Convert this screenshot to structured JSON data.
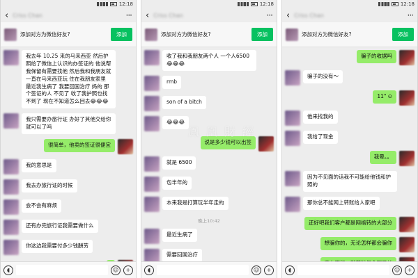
{
  "panels": [
    {
      "status": {
        "time": "12:18"
      },
      "header": {
        "contact_name": "Criss Chan",
        "back_icon": "‹",
        "more_icon": "···"
      },
      "add_friend": {
        "text": "添加对方为微信好友?",
        "button_label": "添加"
      },
      "messages": [
        {
          "side": "left",
          "text": "我去年 10.25 来的马来西亚 然后护照给了微信上认识的办签证的 他说帮我保留有需要找他 然后我和我朋友就一直在马来西亚玩 住在我朋友家里 最近我生病了 我要回国治疗 妈的 那个签证的人 不见了 收了我护照也找不到了 现在不知道怎么回去😂😂😂"
        },
        {
          "side": "left",
          "text": "我只需要办旅行证 办好了其他交给你就可以了吗"
        },
        {
          "side": "right",
          "text": "很简单，他卖的签证很便宜"
        },
        {
          "side": "left",
          "text": "我的意思是"
        },
        {
          "side": "left",
          "text": "我去办旅行证的时候"
        },
        {
          "side": "left",
          "text": "会不会有麻烦"
        },
        {
          "side": "left",
          "text": "还有办完旅行证我需要做什么"
        },
        {
          "side": "left",
          "text": "你这边我需要付多少钱酬劳"
        },
        {
          "side": "right",
          "text": "",
          "partial": true
        }
      ],
      "time_label": ""
    },
    {
      "status": {
        "time": "12:18"
      },
      "header": {
        "contact_name": "Criss Chan",
        "back_icon": "‹",
        "more_icon": "···"
      },
      "add_friend": {
        "text": "添加对方为微信好友?",
        "button_label": "添加"
      },
      "messages": [
        {
          "side": "left",
          "text": "收了我和我朋友两个人 一个人6500😂😂😂"
        },
        {
          "side": "left",
          "text": "rmb"
        },
        {
          "side": "left",
          "text": "son of a bitch"
        },
        {
          "side": "left",
          "text": "😂😂😂"
        },
        {
          "side": "right",
          "text": "说是多少钱可以出签"
        },
        {
          "side": "left",
          "text": "就是 6500"
        },
        {
          "side": "left",
          "text": "包半年的"
        },
        {
          "side": "left",
          "text": "本来我是打算玩半年走的"
        },
        {
          "side": "time",
          "text": "晚上10:42"
        },
        {
          "side": "left",
          "text": "最近生病了"
        },
        {
          "side": "left",
          "text": "需要回国治疗"
        },
        {
          "side": "left",
          "text": "然后找那个人要护照"
        }
      ]
    },
    {
      "status": {
        "time": "12:18"
      },
      "header": {
        "contact_name": "Criss Chan",
        "back_icon": "‹",
        "more_icon": "···"
      },
      "add_friend": {
        "text": "添加对方为微信好友?",
        "button_label": "添加"
      },
      "messages": [
        {
          "side": "right",
          "text": "骗子的收据吗"
        },
        {
          "side": "left",
          "text": "骗子的没有～"
        },
        {
          "side": "right",
          "text": "11\" ⊙"
        },
        {
          "side": "left",
          "text": "他来找我的"
        },
        {
          "side": "left",
          "text": "我给了现金"
        },
        {
          "side": "right",
          "text": "我晕。。"
        },
        {
          "side": "left",
          "text": "因为不见面的话我不可能给他钱和护照的"
        },
        {
          "side": "left",
          "text": "那你总不能网上转账给人家吧"
        },
        {
          "side": "right",
          "text": "还好吧我们客户都是网络转的大部分"
        },
        {
          "side": "right",
          "text": "想骗你的，无论怎样都会骗你"
        },
        {
          "side": "right",
          "text": "实在不行，就花钱保命啊兄弟"
        }
      ]
    }
  ],
  "watermark": "鳳凰財經"
}
